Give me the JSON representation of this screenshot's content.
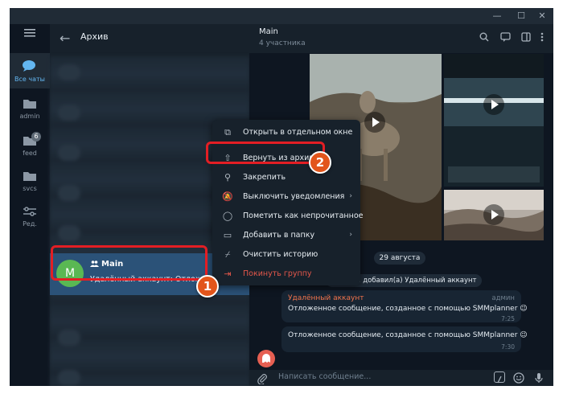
{
  "window": {
    "min": "—",
    "max": "☐",
    "close": "✕"
  },
  "rail": {
    "items": [
      {
        "label": "Все чаты",
        "icon": "chat-bubbles-icon"
      },
      {
        "label": "admin",
        "icon": "folder-icon"
      },
      {
        "label": "feed",
        "icon": "folder-icon",
        "badge": "6"
      },
      {
        "label": "svcs",
        "icon": "folder-icon"
      },
      {
        "label": "Ред.",
        "icon": "edit-filters-icon"
      }
    ]
  },
  "list": {
    "title": "Архив",
    "chat": {
      "avatar_letter": "M",
      "name": "Main",
      "preview": "Удалённый аккаунт: Отложенное"
    }
  },
  "chat": {
    "title": "Main",
    "subtitle": "4 участника",
    "date": "29 августа",
    "system_message": "Алексей добавил(а) Удалённый аккаунт",
    "messages": [
      {
        "author": "Удалённый аккаунт",
        "role": "админ",
        "text": "Отложенное сообщение, созданное с помощью SMMplanner 😉",
        "time": "7:25"
      },
      {
        "text": "Отложенное сообщение, созданное с помощью SMMplanner 😉",
        "time": "7:30"
      }
    ],
    "composer_placeholder": "Написать сообщение..."
  },
  "menu": {
    "items": [
      {
        "label": "Открыть в отдельном окне",
        "icon": "new-window-icon"
      },
      {
        "label": "Вернуть из архива",
        "icon": "unarchive-icon"
      },
      {
        "label": "Закрепить",
        "icon": "pin-icon"
      },
      {
        "label": "Выключить уведомления",
        "icon": "mute-icon",
        "submenu": true
      },
      {
        "label": "Пометить как непрочитанное",
        "icon": "mark-unread-icon"
      },
      {
        "label": "Добавить в папку",
        "icon": "folder-add-icon",
        "submenu": true
      },
      {
        "label": "Очистить историю",
        "icon": "broom-icon"
      },
      {
        "label": "Покинуть группу",
        "icon": "leave-icon",
        "danger": true
      }
    ]
  },
  "annotations": {
    "step1": "1",
    "step2": "2",
    "highlight_color": "#e31e24"
  }
}
